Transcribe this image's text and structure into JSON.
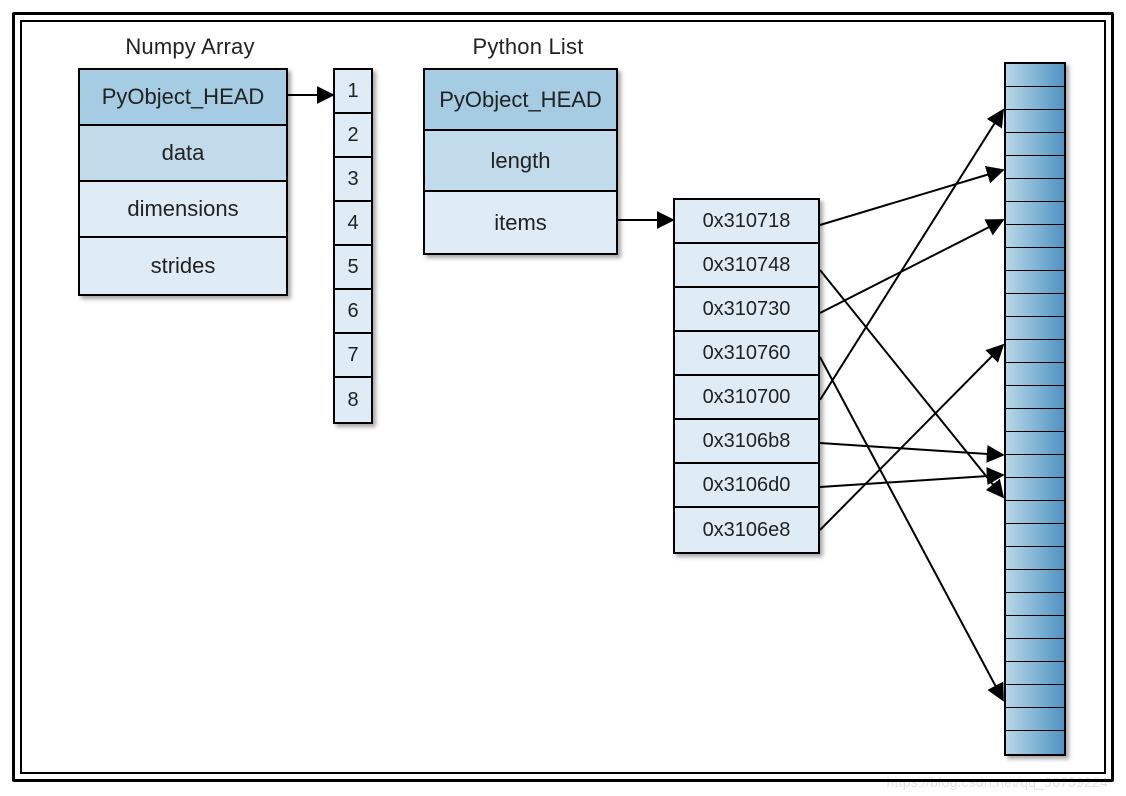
{
  "numpy": {
    "title": "Numpy Array",
    "fields": [
      "PyObject_HEAD",
      "data",
      "dimensions",
      "strides"
    ]
  },
  "array_values": [
    "1",
    "2",
    "3",
    "4",
    "5",
    "6",
    "7",
    "8"
  ],
  "pylist": {
    "title": "Python List",
    "fields": [
      "PyObject_HEAD",
      "length",
      "items"
    ]
  },
  "pointers": [
    "0x310718",
    "0x310748",
    "0x310730",
    "0x310760",
    "0x310700",
    "0x3106b8",
    "0x3106d0",
    "0x3106e8"
  ],
  "memory_slots": 30,
  "arrows": {
    "simple": [
      {
        "from": [
          288,
          95
        ],
        "to": [
          333,
          95
        ]
      },
      {
        "from": [
          616,
          220
        ],
        "to": [
          673,
          220
        ]
      }
    ],
    "scatter": [
      {
        "from": [
          820,
          225
        ],
        "to": [
          1003,
          170
        ]
      },
      {
        "from": [
          820,
          270
        ],
        "to": [
          1003,
          497
        ]
      },
      {
        "from": [
          820,
          313
        ],
        "to": [
          1003,
          220
        ]
      },
      {
        "from": [
          820,
          357
        ],
        "to": [
          1003,
          700
        ]
      },
      {
        "from": [
          820,
          400
        ],
        "to": [
          1003,
          110
        ]
      },
      {
        "from": [
          820,
          443
        ],
        "to": [
          1003,
          455
        ]
      },
      {
        "from": [
          820,
          487
        ],
        "to": [
          1003,
          475
        ]
      },
      {
        "from": [
          820,
          530
        ],
        "to": [
          1003,
          345
        ]
      }
    ]
  },
  "watermark": "https://blog.csdn.net/qq_36759224"
}
